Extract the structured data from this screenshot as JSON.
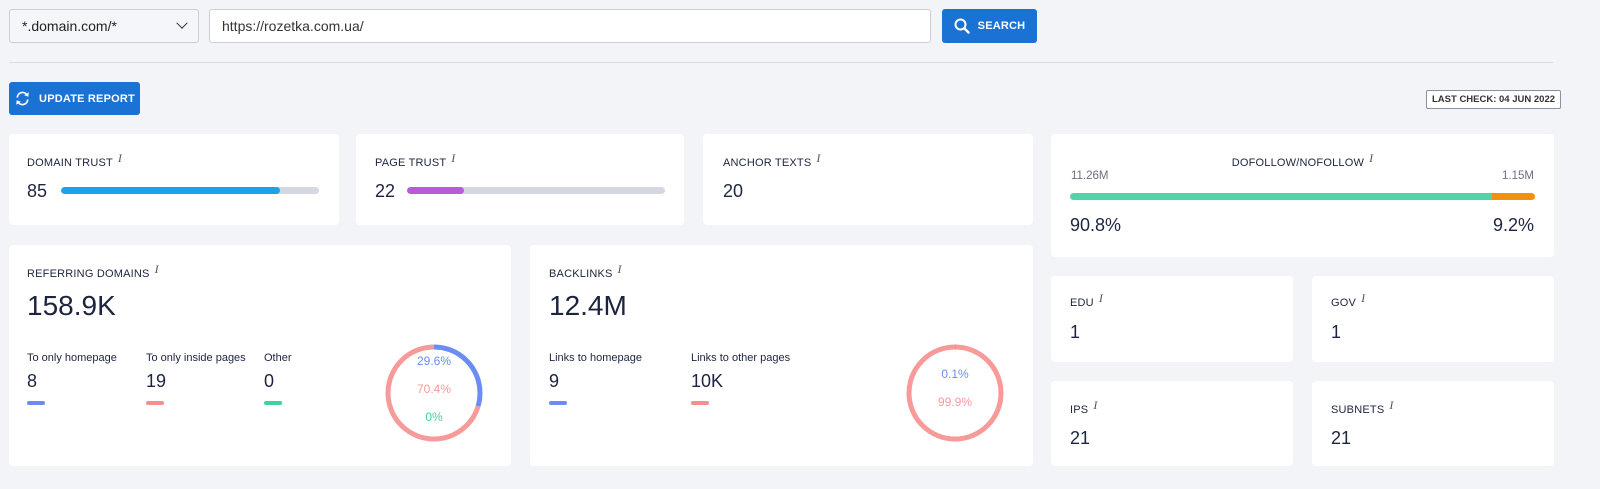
{
  "search": {
    "scope_value": "*.domain.com/*",
    "url_value": "https://rozetka.com.ua/",
    "search_label": "SEARCH"
  },
  "toolbar": {
    "update_label": "UPDATE REPORT",
    "last_check": "LAST CHECK: 04 JUN 2022"
  },
  "domain_trust": {
    "label": "DOMAIN TRUST",
    "info": "i",
    "value": "85",
    "fraction": 0.85,
    "color": "#1aa3e8"
  },
  "page_trust": {
    "label": "PAGE TRUST",
    "info": "i",
    "value": "22",
    "fraction": 0.22,
    "color": "#b95ad8"
  },
  "anchor_texts": {
    "label": "ANCHOR TEXTS",
    "info": "i",
    "value": "20"
  },
  "dofollow": {
    "label": "DOFOLLOW/NOFOLLOW",
    "info": "i",
    "dofollow_count": "11.26M",
    "nofollow_count": "1.15M",
    "dofollow_pct": "90.8%",
    "nofollow_pct": "9.2%",
    "dofollow_fraction": 0.908,
    "dofollow_color": "#4fd6a8",
    "nofollow_color": "#f5900f"
  },
  "referring_domains": {
    "label": "REFERRING DOMAINS",
    "info": "i",
    "value": "158.9K",
    "items": [
      {
        "label": "To only homepage",
        "value": "8",
        "color": "#6b8cf2"
      },
      {
        "label": "To only inside pages",
        "value": "19",
        "color": "#f58f8f"
      },
      {
        "label": "Other",
        "value": "0",
        "color": "#3fd1a0"
      }
    ],
    "donut": [
      {
        "pct": "29.6%",
        "fraction": 0.296,
        "color": "#6b8cf2"
      },
      {
        "pct": "70.4%",
        "fraction": 0.704,
        "color": "#f79a9a"
      },
      {
        "pct": "0%",
        "fraction": 0,
        "color": "#3fd1a0"
      }
    ]
  },
  "backlinks": {
    "label": "BACKLINKS",
    "info": "i",
    "value": "12.4M",
    "items": [
      {
        "label": "Links to homepage",
        "value": "9",
        "color": "#6b8cf2"
      },
      {
        "label": "Links to other pages",
        "value": "10K",
        "color": "#f58f8f"
      }
    ],
    "donut": [
      {
        "pct": "0.1%",
        "fraction": 0.001,
        "color": "#6b8cf2"
      },
      {
        "pct": "99.9%",
        "fraction": 0.999,
        "color": "#f79a9a"
      }
    ]
  },
  "edu": {
    "label": "EDU",
    "info": "i",
    "value": "1"
  },
  "gov": {
    "label": "GOV",
    "info": "i",
    "value": "1"
  },
  "ips": {
    "label": "IPS",
    "info": "i",
    "value": "21"
  },
  "subnets": {
    "label": "SUBNETS",
    "info": "i",
    "value": "21"
  }
}
